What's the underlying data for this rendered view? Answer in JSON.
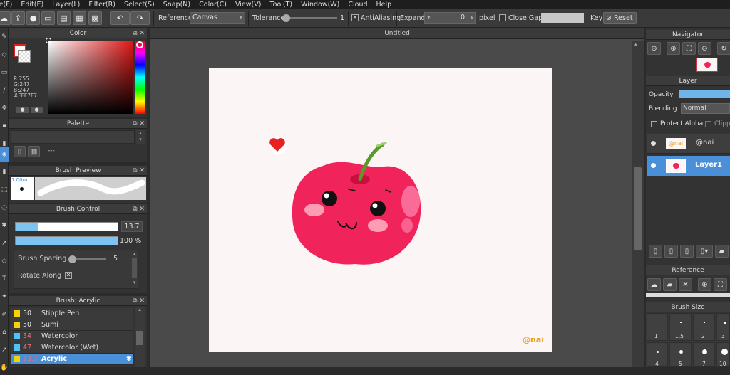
{
  "menu": [
    "le(F)",
    "Edit(E)",
    "Layer(L)",
    "Filter(R)",
    "Select(S)",
    "Snap(N)",
    "Color(C)",
    "View(V)",
    "Tool(T)",
    "Window(W)",
    "Cloud",
    "Help"
  ],
  "toolbar": {
    "reference_label": "Reference",
    "reference_value": "Canvas",
    "tolerance_label": "Tolerance",
    "tolerance_value": "1",
    "antialiasing_label": "AntiAliasing",
    "antialiasing_check": "✕",
    "expand_label": "Expand",
    "expand_value": "0",
    "expand_unit": "pixel",
    "close_gaps_label": "Close Gaps",
    "key_label": "Key",
    "reset_label": "Reset"
  },
  "color_panel": {
    "title": "Color",
    "r": "R:255",
    "g": "G:247",
    "b": "B:247",
    "hex": "#FFF7F7"
  },
  "palette_panel": {
    "title": "Palette",
    "dash": "---"
  },
  "brush_preview": {
    "title": "Brush Preview",
    "size": "1.00m"
  },
  "brush_control": {
    "title": "Brush Control",
    "size_value": "13.7",
    "opacity_value": "100 %",
    "size_level": 0.22,
    "opacity_level": 1.0,
    "spacing_label": "Brush Spacing",
    "spacing_value": "5",
    "rotate_label": "Rotate Along",
    "rotate_check": "✕"
  },
  "brush_list": {
    "title": "Brush: Acrylic",
    "items": [
      {
        "size": "50",
        "name": "Stipple Pen",
        "color": "#f5d10a",
        "size_color": "#dddddd"
      },
      {
        "size": "50",
        "name": "Sumi",
        "color": "#f5d10a",
        "size_color": "#dddddd"
      },
      {
        "size": "34",
        "name": "Watercolor",
        "color": "#4fc3f7",
        "size_color": "#e57373"
      },
      {
        "size": "47",
        "name": "Watercolor (Wet)",
        "color": "#4fc3f7",
        "size_color": "#e57373"
      },
      {
        "size": "13.7",
        "name": "Acrylic",
        "color": "#f5d10a",
        "size_color": "#e57373",
        "selected": true
      }
    ]
  },
  "document": {
    "title": "Untitled",
    "watermark": "@nai"
  },
  "navigator": {
    "title": "Navigator"
  },
  "layer_panel": {
    "title": "Layer",
    "opacity_label": "Opacity",
    "blending_label": "Blending",
    "blending_value": "Normal",
    "protect_alpha": "Protect Alpha",
    "clipping": "Clippi",
    "layers": [
      {
        "name": "@nai",
        "thumb": "@nai",
        "selected": false
      },
      {
        "name": "Layer1",
        "thumb": "",
        "selected": true
      }
    ]
  },
  "reference_panel": {
    "title": "Reference"
  },
  "brush_size_panel": {
    "title": "Brush Size",
    "labels": [
      "1",
      "1.5",
      "2",
      "3",
      "4",
      "5",
      "7",
      "10"
    ]
  },
  "colors": {
    "accent": "#4a90d9",
    "selected_row": "#4a90d9",
    "apple": "#f0245a"
  }
}
